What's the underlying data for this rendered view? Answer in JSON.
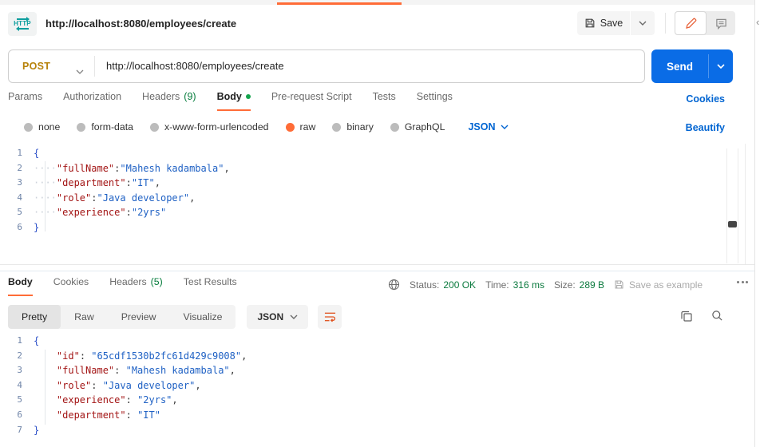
{
  "colors": {
    "accent_orange": "#ff6c37",
    "link_blue": "#0265d2",
    "send_blue": "#0a6ce6",
    "method_post": "#b7820a",
    "count_green": "#067c3c",
    "status_green": "#0b7a3e",
    "code_key": "#a31515",
    "code_string": "#1f61c4",
    "code_brace": "#2c50c8"
  },
  "header": {
    "http_badge": "HTTP",
    "tab_title": "http://localhost:8080/employees/create",
    "save_label": "Save"
  },
  "request": {
    "method": "POST",
    "url": "http://localhost:8080/employees/create",
    "send_label": "Send",
    "cookies_link": "Cookies",
    "beautify_link": "Beautify",
    "tabs": [
      {
        "label": "Params"
      },
      {
        "label": "Authorization"
      },
      {
        "label": "Headers",
        "count": "(9)"
      },
      {
        "label": "Body",
        "active": true
      },
      {
        "label": "Pre-request Script"
      },
      {
        "label": "Tests"
      },
      {
        "label": "Settings"
      }
    ],
    "body_modes": [
      {
        "label": "none"
      },
      {
        "label": "form-data"
      },
      {
        "label": "x-www-form-urlencoded"
      },
      {
        "label": "raw",
        "selected": true
      },
      {
        "label": "binary"
      },
      {
        "label": "GraphQL"
      }
    ],
    "content_type": "JSON",
    "body_editor": {
      "lines": [
        {
          "n": "1",
          "t": [
            [
              "br",
              "{"
            ]
          ]
        },
        {
          "n": "2",
          "t": [
            [
              "ws",
              "····"
            ],
            [
              "key",
              "\"fullName\""
            ],
            [
              "pn",
              ":"
            ],
            [
              "str",
              "\"Mahesh kadambala\""
            ],
            [
              "pn",
              ","
            ]
          ]
        },
        {
          "n": "3",
          "t": [
            [
              "ws",
              "····"
            ],
            [
              "key",
              "\"department\""
            ],
            [
              "pn",
              ":"
            ],
            [
              "str",
              "\"IT\""
            ],
            [
              "pn",
              ","
            ]
          ]
        },
        {
          "n": "4",
          "t": [
            [
              "ws",
              "····"
            ],
            [
              "key",
              "\"role\""
            ],
            [
              "pn",
              ":"
            ],
            [
              "str",
              "\"Java developer\""
            ],
            [
              "pn",
              ","
            ]
          ]
        },
        {
          "n": "5",
          "t": [
            [
              "ws",
              "····"
            ],
            [
              "key",
              "\"experience\""
            ],
            [
              "pn",
              ":"
            ],
            [
              "str",
              "\"2yrs\""
            ]
          ]
        },
        {
          "n": "6",
          "t": [
            [
              "br",
              "}"
            ]
          ]
        }
      ]
    }
  },
  "response": {
    "tabs": [
      {
        "label": "Body",
        "active": true
      },
      {
        "label": "Cookies"
      },
      {
        "label": "Headers",
        "count": "(5)"
      },
      {
        "label": "Test Results"
      }
    ],
    "meta": {
      "status_label": "Status:",
      "status_value": "200 OK",
      "time_label": "Time:",
      "time_value": "316 ms",
      "size_label": "Size:",
      "size_value": "289 B",
      "save_as_example": "Save as example"
    },
    "view_tabs": [
      {
        "label": "Pretty",
        "active": true
      },
      {
        "label": "Raw"
      },
      {
        "label": "Preview"
      },
      {
        "label": "Visualize"
      }
    ],
    "content_type": "JSON",
    "body_editor": {
      "lines": [
        {
          "n": "1",
          "t": [
            [
              "br",
              "{"
            ]
          ]
        },
        {
          "n": "2",
          "t": [
            [
              "ws",
              "    "
            ],
            [
              "key",
              "\"id\""
            ],
            [
              "pn",
              ": "
            ],
            [
              "str",
              "\"65cdf1530b2fc61d429c9008\""
            ],
            [
              "pn",
              ","
            ]
          ]
        },
        {
          "n": "3",
          "t": [
            [
              "ws",
              "    "
            ],
            [
              "key",
              "\"fullName\""
            ],
            [
              "pn",
              ": "
            ],
            [
              "str",
              "\"Mahesh kadambala\""
            ],
            [
              "pn",
              ","
            ]
          ]
        },
        {
          "n": "4",
          "t": [
            [
              "ws",
              "    "
            ],
            [
              "key",
              "\"role\""
            ],
            [
              "pn",
              ": "
            ],
            [
              "str",
              "\"Java developer\""
            ],
            [
              "pn",
              ","
            ]
          ]
        },
        {
          "n": "5",
          "t": [
            [
              "ws",
              "    "
            ],
            [
              "key",
              "\"experience\""
            ],
            [
              "pn",
              ": "
            ],
            [
              "str",
              "\"2yrs\""
            ],
            [
              "pn",
              ","
            ]
          ]
        },
        {
          "n": "6",
          "t": [
            [
              "ws",
              "    "
            ],
            [
              "key",
              "\"department\""
            ],
            [
              "pn",
              ": "
            ],
            [
              "str",
              "\"IT\""
            ]
          ]
        },
        {
          "n": "7",
          "t": [
            [
              "br",
              "}"
            ]
          ]
        }
      ]
    }
  }
}
